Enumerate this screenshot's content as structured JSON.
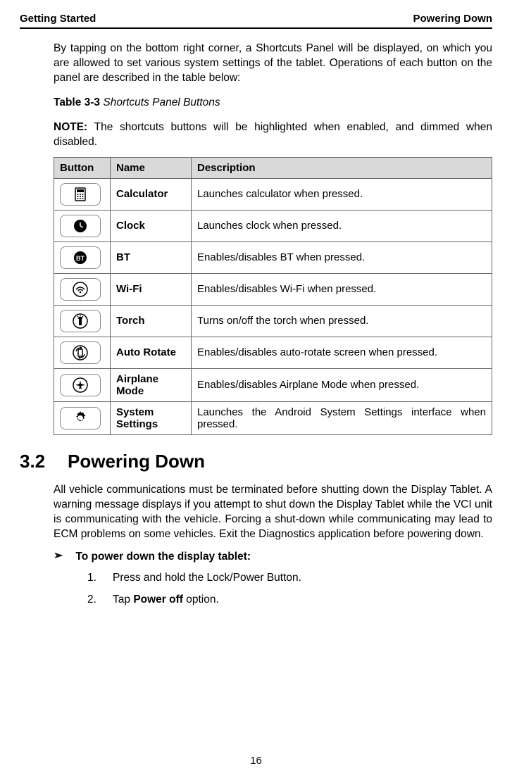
{
  "header": {
    "left": "Getting Started",
    "right": "Powering Down"
  },
  "intro_para": "By tapping on the bottom right corner, a Shortcuts Panel will be displayed, on which you are allowed to set various system settings of the tablet. Operations of each button on the panel are described in the table below:",
  "table_title_label": "Table 3-3",
  "table_title_caption": "Shortcuts Panel Buttons",
  "note_label": "NOTE:",
  "note_text": " The shortcuts buttons will be highlighted when enabled, and dimmed when disabled.",
  "table": {
    "headers": {
      "button": "Button",
      "name": "Name",
      "description": "Description"
    },
    "rows": [
      {
        "icon": "calculator",
        "name": "Calculator",
        "desc": "Launches calculator when pressed."
      },
      {
        "icon": "clock",
        "name": "Clock",
        "desc": "Launches clock when pressed."
      },
      {
        "icon": "bt",
        "name": "BT",
        "desc": "Enables/disables BT when pressed."
      },
      {
        "icon": "wifi",
        "name": "Wi-Fi",
        "desc": "Enables/disables Wi-Fi when pressed."
      },
      {
        "icon": "torch",
        "name": "Torch",
        "desc": "Turns on/off the torch when pressed."
      },
      {
        "icon": "autorotate",
        "name": "Auto Rotate",
        "desc": "Enables/disables auto-rotate screen when pressed."
      },
      {
        "icon": "airplane",
        "name": "Airplane Mode",
        "desc": "Enables/disables Airplane Mode when pressed."
      },
      {
        "icon": "settings",
        "name": "System Settings",
        "desc": "Launches the Android System Settings interface when pressed."
      }
    ]
  },
  "section": {
    "number": "3.2",
    "title": "Powering Down",
    "para": "All vehicle communications must be terminated before shutting down the Display Tablet. A warning message displays if you attempt to shut down the Display Tablet while the VCI unit is communicating with the vehicle. Forcing a shut-down while communicating may lead to ECM problems on some vehicles. Exit the Diagnostics application before powering down.",
    "procedure_lead": "To power down the display tablet:",
    "steps": [
      {
        "num": "1.",
        "text_before": "Press and hold the Lock/Power Button.",
        "bold": "",
        "text_after": ""
      },
      {
        "num": "2.",
        "text_before": "Tap ",
        "bold": "Power off",
        "text_after": " option."
      }
    ]
  },
  "page_number": "16"
}
